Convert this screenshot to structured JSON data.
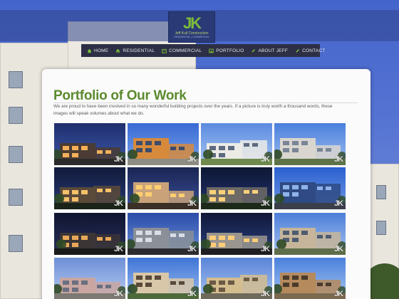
{
  "brand": {
    "mark": "JK",
    "name": "Jeff Kull Construction",
    "tagline": "RESIDENTIAL | COMMERCIAL"
  },
  "nav": {
    "items": [
      {
        "label": "HOME",
        "icon": "home-icon"
      },
      {
        "label": "RESIDENTIAL",
        "icon": "house-icon"
      },
      {
        "label": "COMMERCIAL",
        "icon": "building-icon"
      },
      {
        "label": "PORTFOLIO",
        "icon": "image-icon"
      },
      {
        "label": "ABOUT JEFF",
        "icon": "pencil-icon"
      },
      {
        "label": "CONTACT",
        "icon": "pencil-icon"
      }
    ]
  },
  "page": {
    "title": "Portfolio of Our Work",
    "intro": "We are proud to have been involved in so many wonderful building projects over the years. If a picture is truly worth a thousand words, these images will speak volumes about what we do."
  },
  "portfolio": {
    "watermark": "JK",
    "thumbnails": [
      {
        "scene": "modern-dusk"
      },
      {
        "scene": "orange-modern"
      },
      {
        "scene": "white-modern-day"
      },
      {
        "scene": "condo-tower"
      },
      {
        "scene": "craftsman-night"
      },
      {
        "scene": "lit-entry"
      },
      {
        "scene": "garden-night"
      },
      {
        "scene": "glass-facade"
      },
      {
        "scene": "dark-modern"
      },
      {
        "scene": "urban-corner"
      },
      {
        "scene": "curved-facade"
      },
      {
        "scene": "mixed-use"
      },
      {
        "scene": "pink-condo"
      },
      {
        "scene": "street-row"
      },
      {
        "scene": "arched-court"
      },
      {
        "scene": "courtyard-pergola"
      }
    ]
  },
  "colors": {
    "accent": "#5b8a2e",
    "nav_bg": "#2c2f45",
    "logo_bg": "#2a3a76",
    "sky": "#4465cc"
  }
}
